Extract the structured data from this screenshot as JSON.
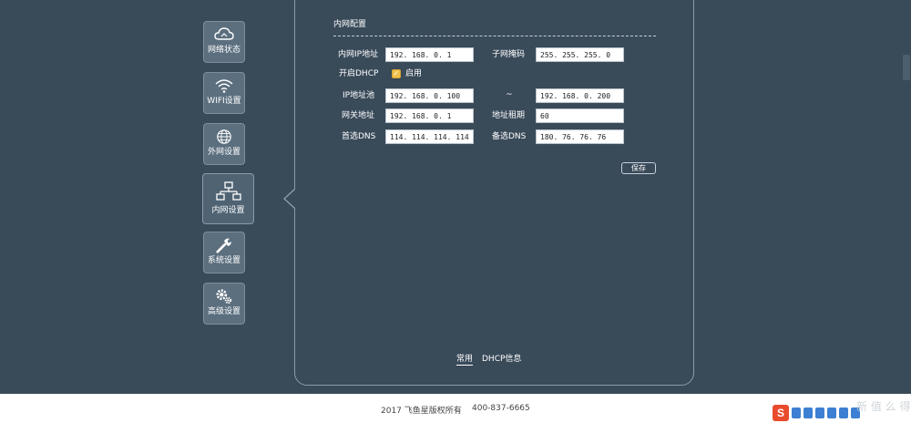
{
  "sidebar": {
    "items": [
      {
        "label": "网络状态",
        "icon": "cloud-icon"
      },
      {
        "label": "WIFI设置",
        "icon": "wifi-icon"
      },
      {
        "label": "外网设置",
        "icon": "globe-icon"
      },
      {
        "label": "内网设置",
        "icon": "network-icon",
        "active": true
      },
      {
        "label": "系统设置",
        "icon": "wrench-icon"
      },
      {
        "label": "高级设置",
        "icon": "gears-icon"
      }
    ]
  },
  "panel": {
    "title": "内网配置",
    "lan_ip_label": "内网IP地址",
    "lan_ip": "192. 168. 0. 1",
    "subnet_label": "子网掩码",
    "subnet": "255. 255. 255. 0",
    "dhcp_label": "开启DHCP",
    "dhcp_enable_label": "启用",
    "dhcp_enabled": true,
    "pool_label": "IP地址池",
    "pool_start": "192. 168. 0. 100",
    "pool_sep": "~",
    "pool_end": "192. 168. 0. 200",
    "gateway_label": "网关地址",
    "gateway": "192. 168. 0. 1",
    "lease_label": "地址租期",
    "lease": "60",
    "dns1_label": "首选DNS",
    "dns1": "114. 114. 114. 114",
    "dns2_label": "备选DNS",
    "dns2": "180. 76. 76. 76",
    "save_label": "保存",
    "tabs": [
      {
        "label": "常用",
        "active": true
      },
      {
        "label": "DHCP信息"
      }
    ]
  },
  "footer": {
    "copyright": "2017 飞鱼星版权所有",
    "phone": "400-837-6665"
  },
  "overlay": {
    "ime_label": "S",
    "watermark": "新 值 么 得"
  },
  "colors": {
    "background": "#394a59",
    "checkbox_accent": "#f2c14a",
    "footer_bg": "#ffffff",
    "ime_brand": "#e94b2c"
  }
}
